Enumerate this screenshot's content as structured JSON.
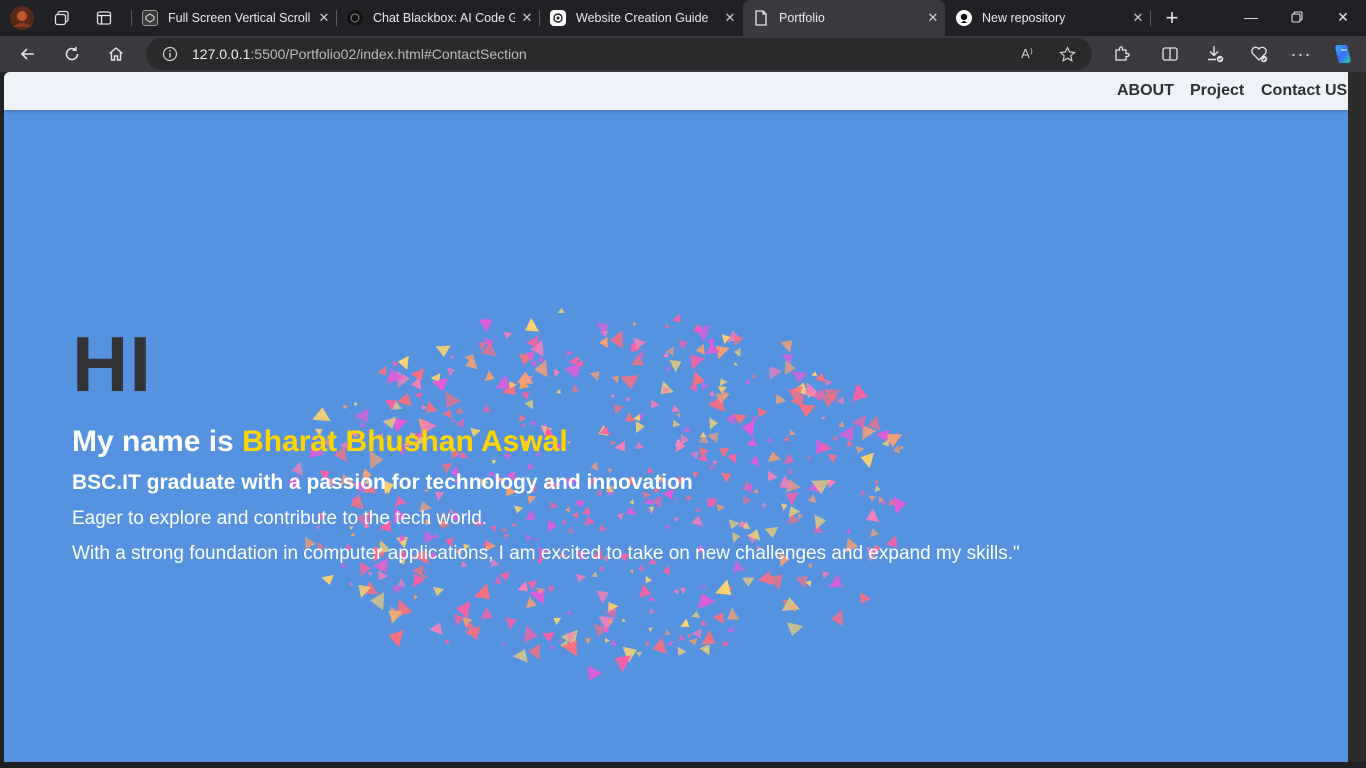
{
  "browser": {
    "tabs": [
      {
        "label": "Full Screen Vertical Scroll S",
        "favicon": "codepen-icon",
        "active": false
      },
      {
        "label": "Chat Blackbox: AI Code Ger",
        "favicon": "blackbox-icon",
        "active": false
      },
      {
        "label": "Website Creation Guide",
        "favicon": "chatgpt-icon",
        "active": false
      },
      {
        "label": "Portfolio",
        "favicon": "page-icon",
        "active": true
      },
      {
        "label": "New repository",
        "favicon": "github-icon",
        "active": false
      }
    ],
    "address": {
      "host": "127.0.0.1",
      "path": ":5500/Portfolio02/index.html#ContactSection"
    },
    "read_aloud_label": "A⁾"
  },
  "nav": {
    "items": [
      "ABOUT",
      "Project",
      "Contact US"
    ]
  },
  "hero": {
    "greeting": "HI",
    "name_prefix": "My name is ",
    "name": "Bharat Bhushan Aswal",
    "tagline": "BSC.IT graduate with a passion for technology and innovation",
    "line1": "Eager to explore and contribute to the tech world.",
    "line2": "With a strong foundation in computer applications, I am excited to take on new challenges and expand my skills.\""
  },
  "colors": {
    "page_background": "#5593e1",
    "accent_name": "#ffd500",
    "greeting_text": "#333437",
    "particle_colors": [
      "#ff5fa2",
      "#ff7eb6",
      "#ff9f6b",
      "#ffd36b",
      "#e85bd8",
      "#ff6f7d"
    ]
  }
}
